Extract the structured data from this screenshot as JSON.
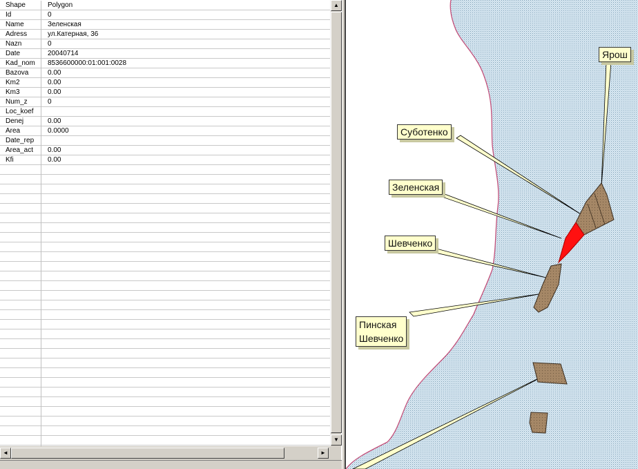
{
  "attributes": [
    {
      "field": "Shape",
      "value": "Polygon"
    },
    {
      "field": "Id",
      "value": "0"
    },
    {
      "field": "Name",
      "value": "Зеленская"
    },
    {
      "field": "Adress",
      "value": "ул.Катерная, 36"
    },
    {
      "field": "Nazn",
      "value": "0"
    },
    {
      "field": "Date",
      "value": "20040714"
    },
    {
      "field": "Kad_nom",
      "value": "8536600000:01:001:0028"
    },
    {
      "field": "Bazova",
      "value": "0.00"
    },
    {
      "field": "Km2",
      "value": "0.00"
    },
    {
      "field": "Km3",
      "value": "0.00"
    },
    {
      "field": "Num_z",
      "value": "0"
    },
    {
      "field": "Loc_koef",
      "value": ""
    },
    {
      "field": "Denej",
      "value": "0.00"
    },
    {
      "field": "Area",
      "value": "0.0000"
    },
    {
      "field": "Date_rep",
      "value": ""
    },
    {
      "field": "Area_act",
      "value": "0.00"
    },
    {
      "field": "Kfi",
      "value": "0.00"
    }
  ],
  "scroll": {
    "up_icon": "arrow-up-icon",
    "down_icon": "arrow-down-icon",
    "left_icon": "arrow-left-icon",
    "right_icon": "arrow-right-icon",
    "up_glyph": "▲",
    "down_glyph": "▼",
    "left_glyph": "◄",
    "right_glyph": "►"
  },
  "map": {
    "labels": {
      "yarosh": "Ярош",
      "subotenko": "Суботенко",
      "zelenskaya": "Зеленская",
      "shevchenko": "Шевченко",
      "pinskaya_1": "Пинская",
      "pinskaya_2": "Шевченко"
    },
    "colors": {
      "water": "#cfe1ee",
      "shore": "#c4507a",
      "parcel": "#a58766",
      "selected_parcel": "#ff0000",
      "callout_bg": "#ffffcc"
    }
  }
}
